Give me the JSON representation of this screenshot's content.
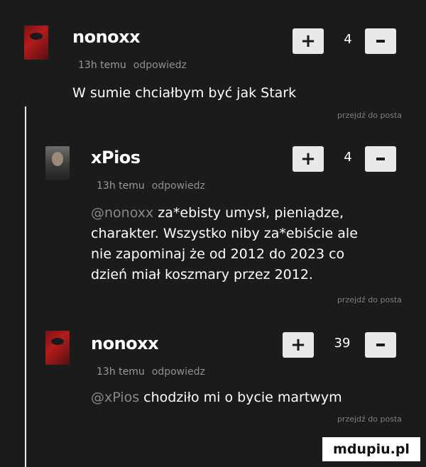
{
  "comments": [
    {
      "author": "nonoxx",
      "time": "13h temu",
      "reply": "odpowiedz",
      "body": "W sumie chciałbym być jak Stark",
      "mention": "",
      "score": "4",
      "goto": "przejdź do posta"
    },
    {
      "author": "xPios",
      "time": "13h temu",
      "reply": "odpowiedz",
      "mention": "@nonoxx",
      "body_line1": "za*ebisty umysł, pieniądze,",
      "body_line2": "charakter. Wszystko niby za*ebiście ale",
      "body_line3": "nie zapominaj że od 2012 do 2023 co",
      "body_line4": "dzień miał koszmary przez 2012.",
      "score": "4",
      "goto": "przejdź do posta"
    },
    {
      "author": "nonoxx",
      "time": "13h temu",
      "reply": "odpowiedz",
      "mention": "@xPios",
      "body": "chodziło mi o bycie martwym",
      "score": "39",
      "goto": "przejdź do posta"
    }
  ],
  "watermark": "mdupiu.pl"
}
